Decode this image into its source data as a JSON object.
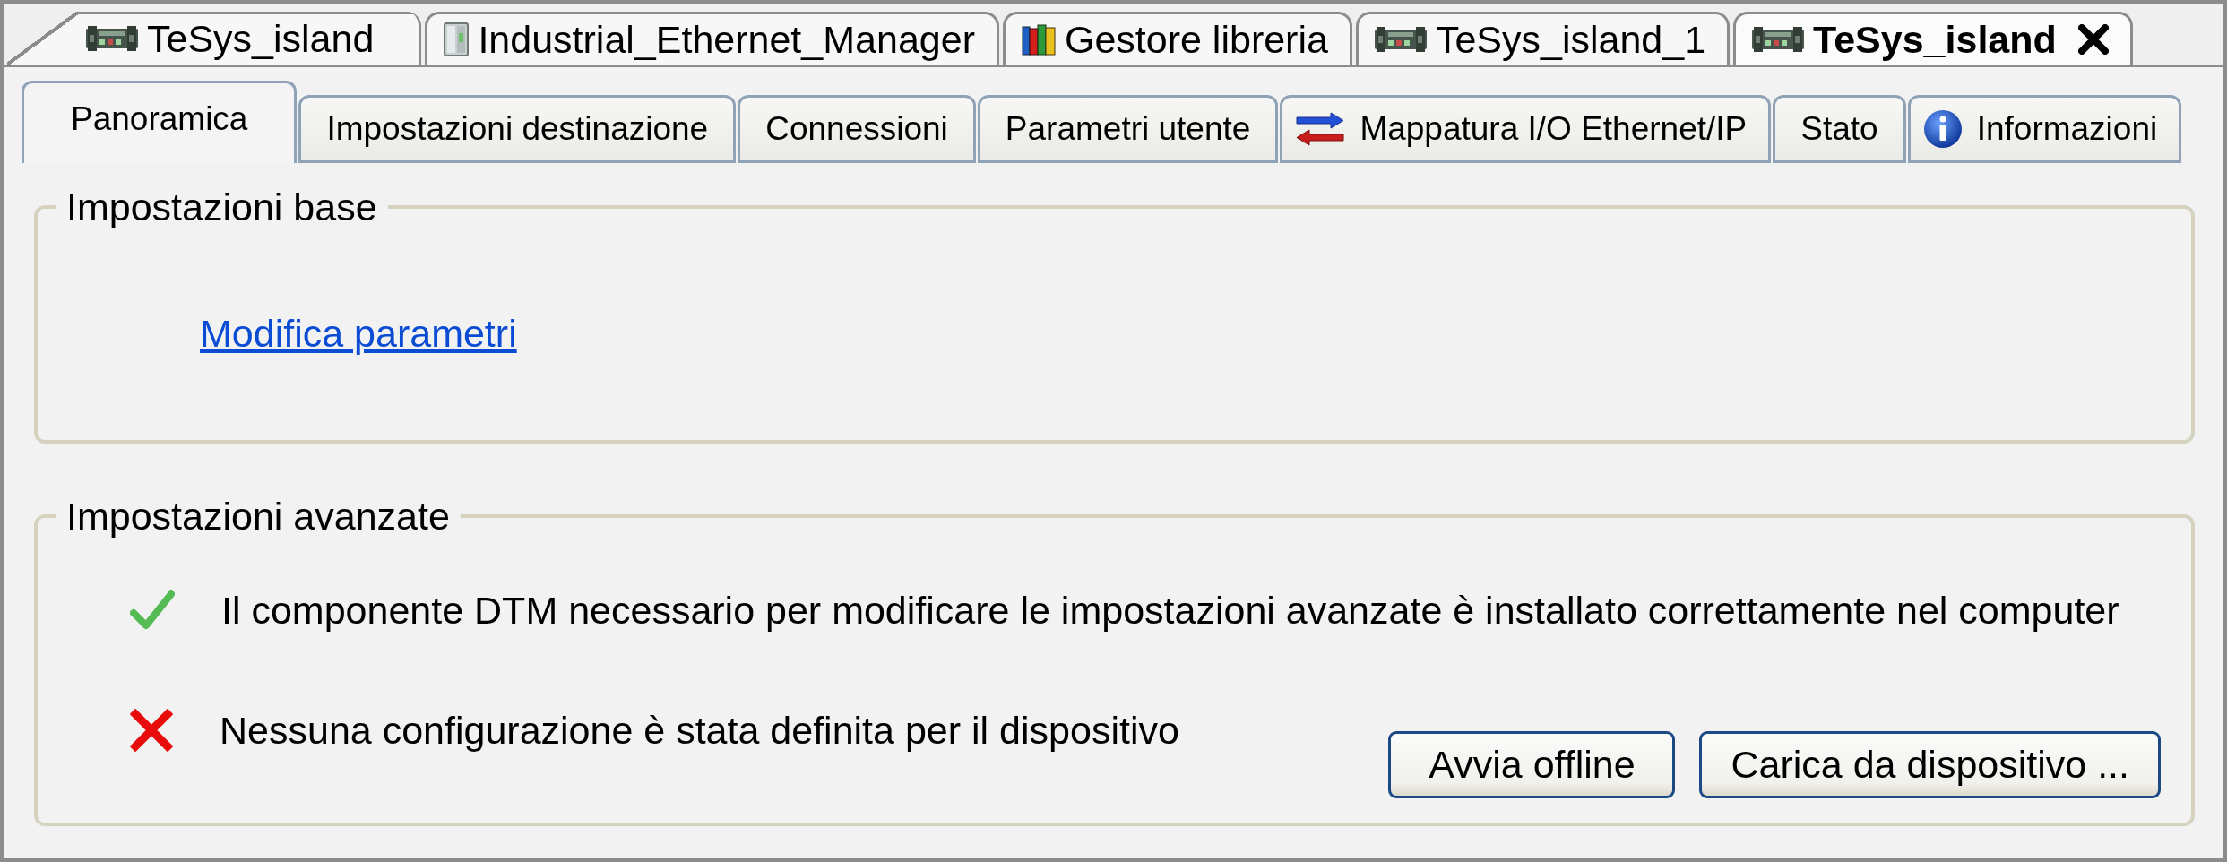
{
  "document_tabs": [
    {
      "label": "TeSys_island",
      "kind": "device",
      "selected": false
    },
    {
      "label": "Industrial_Ethernet_Manager",
      "kind": "manager",
      "selected": false
    },
    {
      "label": "Gestore libreria",
      "kind": "library",
      "selected": false
    },
    {
      "label": "TeSys_island_1",
      "kind": "device",
      "selected": false
    },
    {
      "label": "TeSys_island",
      "kind": "device",
      "selected": true
    }
  ],
  "page_tabs": [
    {
      "label": "Panoramica",
      "kind": "plain",
      "selected": true
    },
    {
      "label": "Impostazioni destinazione",
      "kind": "plain",
      "selected": false
    },
    {
      "label": "Connessioni",
      "kind": "plain",
      "selected": false
    },
    {
      "label": "Parametri utente",
      "kind": "plain",
      "selected": false
    },
    {
      "label": "Mappatura I/O Ethernet/IP",
      "kind": "mapping",
      "selected": false
    },
    {
      "label": "Stato",
      "kind": "plain",
      "selected": false
    },
    {
      "label": "Informazioni",
      "kind": "info",
      "selected": false
    }
  ],
  "basic_settings": {
    "title": "Impostazioni base",
    "link": "Modifica parametri"
  },
  "advanced_settings": {
    "title": "Impostazioni avanzate",
    "messages": [
      {
        "kind": "success",
        "text": "Il componente DTM necessario per modificare le impostazioni avanzate è installato correttamente nel computer"
      },
      {
        "kind": "error",
        "text": "Nessuna configurazione è stata definita per il dispositivo"
      }
    ],
    "buttons": [
      "Avvia offline",
      "Carica da dispositivo ..."
    ]
  }
}
